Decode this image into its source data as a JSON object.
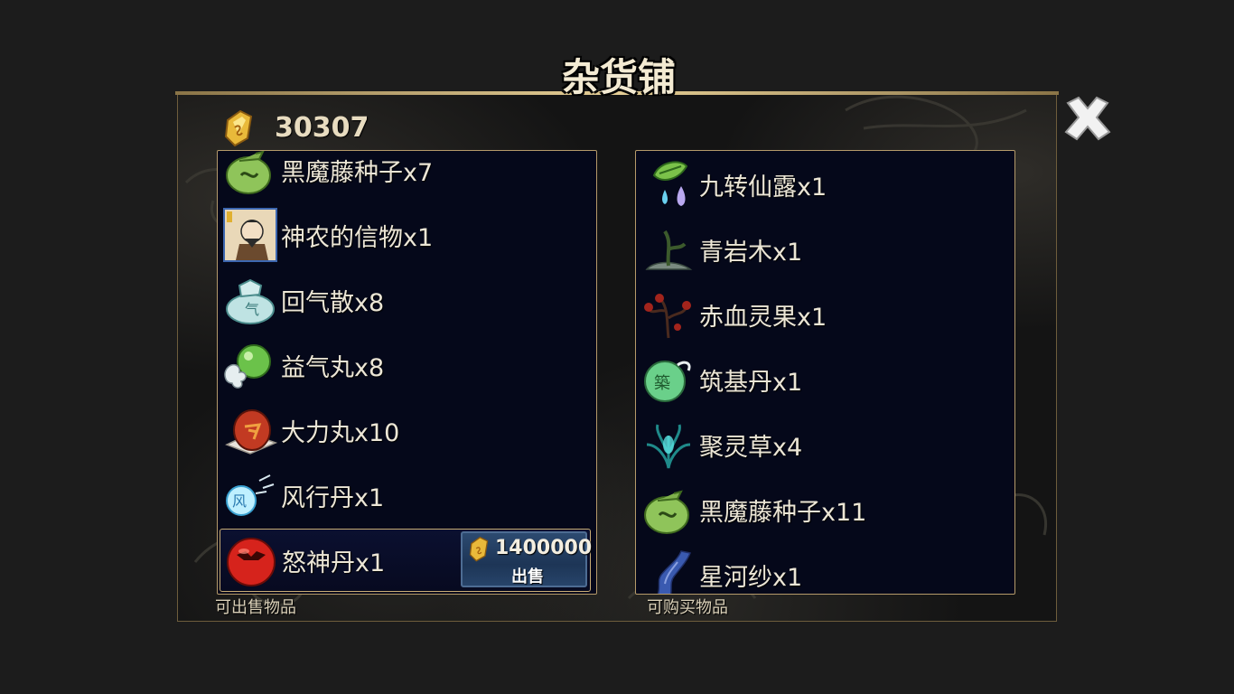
{
  "shop": {
    "title": "杂货铺",
    "gold": "30307",
    "close_icon": "close-x-icon"
  },
  "sell_list": {
    "caption": "可出售物品",
    "items": [
      {
        "name": "黑魔藤种子x7",
        "icon": "seed-bag-icon"
      },
      {
        "name": "神农的信物x1",
        "icon": "shennong-portrait-icon"
      },
      {
        "name": "回气散x8",
        "icon": "qi-powder-bag-icon"
      },
      {
        "name": "益气丸x8",
        "icon": "green-pill-icon"
      },
      {
        "name": "大力丸x10",
        "icon": "red-strength-pill-icon"
      },
      {
        "name": "风行丹x1",
        "icon": "wind-pill-icon"
      },
      {
        "name": "怒神丹x1",
        "icon": "red-rage-pill-icon",
        "selected": true
      }
    ],
    "selected_price": "1400000",
    "sell_label": "出售"
  },
  "buy_list": {
    "caption": "可购买物品",
    "items": [
      {
        "name": "九转仙露x1",
        "icon": "leaf-dew-icon"
      },
      {
        "name": "青岩木x1",
        "icon": "green-wood-icon"
      },
      {
        "name": "赤血灵果x1",
        "icon": "red-fruit-icon"
      },
      {
        "name": "筑基丹x1",
        "icon": "foundation-pill-icon"
      },
      {
        "name": "聚灵草x4",
        "icon": "spirit-grass-icon"
      },
      {
        "name": "黑魔藤种子x11",
        "icon": "seed-bag-icon"
      },
      {
        "name": "星河纱x1",
        "icon": "star-silk-icon"
      }
    ]
  }
}
